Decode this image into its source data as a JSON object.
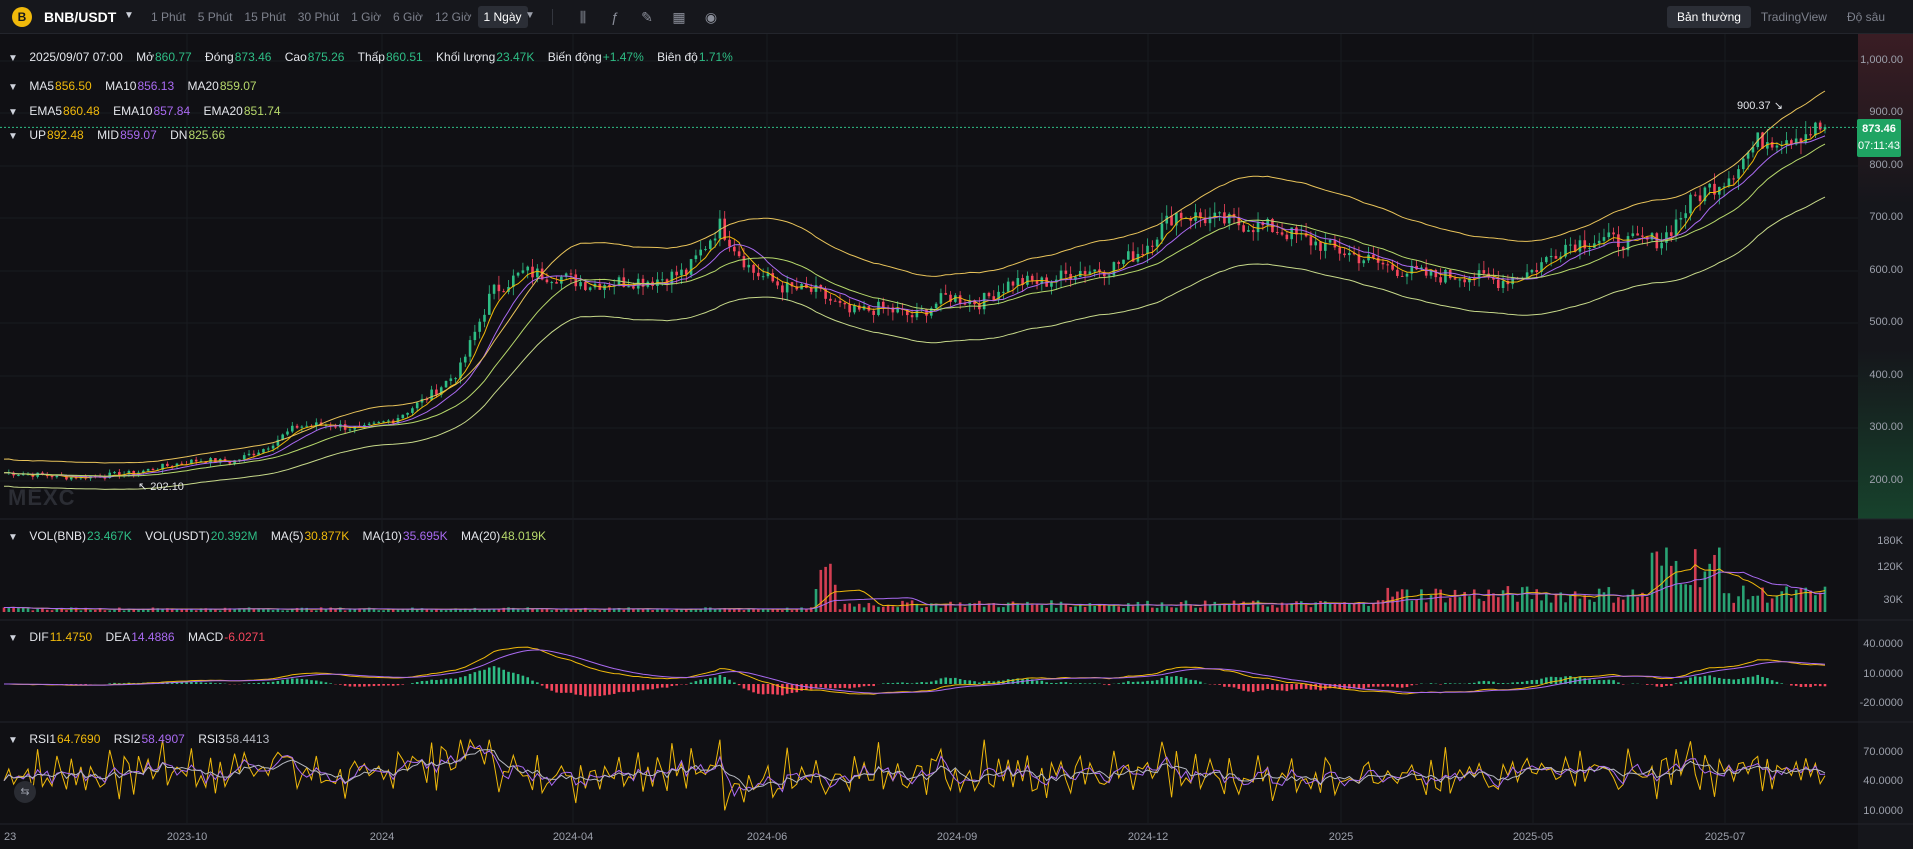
{
  "toolbar": {
    "logo_text": "B",
    "symbol": "BNB/USDT",
    "intervals": [
      "1 Phút",
      "5 Phút",
      "15 Phút",
      "30 Phút",
      "1 Giờ",
      "6 Giờ",
      "12 Giờ",
      "1 Ngày"
    ],
    "active_interval": "1 Ngày",
    "tools": [
      "indicator-icon",
      "formula-icon",
      "pencil-icon",
      "layout-icon",
      "camera-icon"
    ],
    "view_modes": [
      "Bản thường",
      "TradingView",
      "Độ sâu"
    ],
    "active_view_mode": "Bản thường"
  },
  "ohlc": {
    "date": "2025/09/07 07:00",
    "open_label": "Mở",
    "open": "860.77",
    "close_label": "Đóng",
    "close": "873.46",
    "high_label": "Cao",
    "high": "875.26",
    "low_label": "Thấp",
    "low": "860.51",
    "volume_label": "Khối lượng",
    "volume": "23.47K",
    "change_label": "Biến động",
    "change": "+1.47%",
    "amplitude_label": "Biên độ",
    "amplitude": "1.71%"
  },
  "ma": {
    "ma5_label": "MA5",
    "ma5": "856.50",
    "ma10_label": "MA10",
    "ma10": "856.13",
    "ma20_label": "MA20",
    "ma20": "859.07"
  },
  "ema": {
    "ema5_label": "EMA5",
    "ema5": "860.48",
    "ema10_label": "EMA10",
    "ema10": "857.84",
    "ema20_label": "EMA20",
    "ema20": "851.74"
  },
  "boll": {
    "up_label": "UP",
    "up": "892.48",
    "mid_label": "MID",
    "mid": "859.07",
    "dn_label": "DN",
    "dn": "825.66"
  },
  "vol": {
    "bnb_label": "VOL(BNB)",
    "bnb": "23.467K",
    "usdt_label": "VOL(USDT)",
    "usdt": "20.392M",
    "ma5_label": "MA(5)",
    "ma5": "30.877K",
    "ma10_label": "MA(10)",
    "ma10": "35.695K",
    "ma20_label": "MA(20)",
    "ma20": "48.019K"
  },
  "macd": {
    "dif_label": "DIF",
    "dif": "11.4750",
    "dea_label": "DEA",
    "dea": "14.4886",
    "macd_label": "MACD",
    "macd": "-6.0271"
  },
  "rsi": {
    "rsi1_label": "RSI1",
    "rsi1": "64.7690",
    "rsi2_label": "RSI2",
    "rsi2": "58.4907",
    "rsi3_label": "RSI3",
    "rsi3": "58.4413"
  },
  "price_axis": [
    "1,000.00",
    "900.00",
    "800.00",
    "700.00",
    "600.00",
    "500.00",
    "400.00",
    "300.00",
    "200.00"
  ],
  "volume_axis": [
    "180K",
    "120K",
    "30K"
  ],
  "macd_axis": [
    "40.0000",
    "10.0000",
    "-20.0000"
  ],
  "rsi_axis": [
    "70.0000",
    "40.0000",
    "10.0000"
  ],
  "x_axis": [
    "23",
    "2023-10",
    "2024",
    "2024-04",
    "2024-06",
    "2024-09",
    "2024-12",
    "2025",
    "2025-05",
    "2025-07"
  ],
  "current_price": {
    "price": "873.46",
    "countdown": "07:11:43"
  },
  "high_mark": "900.37",
  "low_mark": "202.10",
  "watermark": "MEXC",
  "side_button_icon": "collapse-icon",
  "colors": {
    "up": "#2ebd85",
    "down": "#f6465d",
    "ma5": "#f0b90b",
    "ma10": "#a96af1",
    "ma20": "#b6d86b",
    "background": "#101014"
  },
  "chart_data": {
    "type": "candlestick",
    "dates": [
      "2023-08-28",
      "2023-09-11",
      "2023-09-25",
      "2023-10-09",
      "2023-10-23",
      "2023-11-06",
      "2023-11-20",
      "2023-12-04",
      "2023-12-18",
      "2024-01-01",
      "2024-01-15",
      "2024-01-29",
      "2024-02-12",
      "2024-02-26",
      "2024-03-04",
      "2024-03-11",
      "2024-03-25",
      "2024-04-08",
      "2024-04-22",
      "2024-05-06",
      "2024-05-20",
      "2024-06-03",
      "2024-06-17",
      "2024-07-01",
      "2024-07-15",
      "2024-07-29",
      "2024-08-05",
      "2024-08-19",
      "2024-09-02",
      "2024-09-16",
      "2024-09-30",
      "2024-10-14",
      "2024-10-28",
      "2024-11-11",
      "2024-11-25",
      "2024-12-02",
      "2024-12-16",
      "2024-12-30",
      "2025-01-13",
      "2025-01-27",
      "2025-02-03",
      "2025-02-17",
      "2025-03-03",
      "2025-03-17",
      "2025-03-31",
      "2025-04-14",
      "2025-04-28",
      "2025-05-12",
      "2025-05-26",
      "2025-06-09",
      "2025-06-23",
      "2025-07-07",
      "2025-07-21",
      "2025-08-04",
      "2025-08-18",
      "2025-09-01",
      "2025-09-07"
    ],
    "close": [
      216,
      212,
      207,
      210,
      215,
      229,
      240,
      236,
      262,
      304,
      308,
      298,
      318,
      358,
      410,
      560,
      598,
      590,
      575,
      580,
      583,
      598,
      688,
      600,
      568,
      560,
      520,
      530,
      512,
      552,
      540,
      580,
      578,
      600,
      605,
      640,
      710,
      700,
      690,
      682,
      660,
      640,
      620,
      600,
      590,
      592,
      580,
      600,
      650,
      660,
      655,
      660,
      740,
      780,
      850,
      858,
      873.46
    ],
    "ylim": [
      150,
      1000
    ],
    "volume_ylim": [
      0,
      220000
    ],
    "macd_ylim": [
      -35,
      55
    ],
    "rsi_ylim": [
      0,
      100
    ]
  }
}
